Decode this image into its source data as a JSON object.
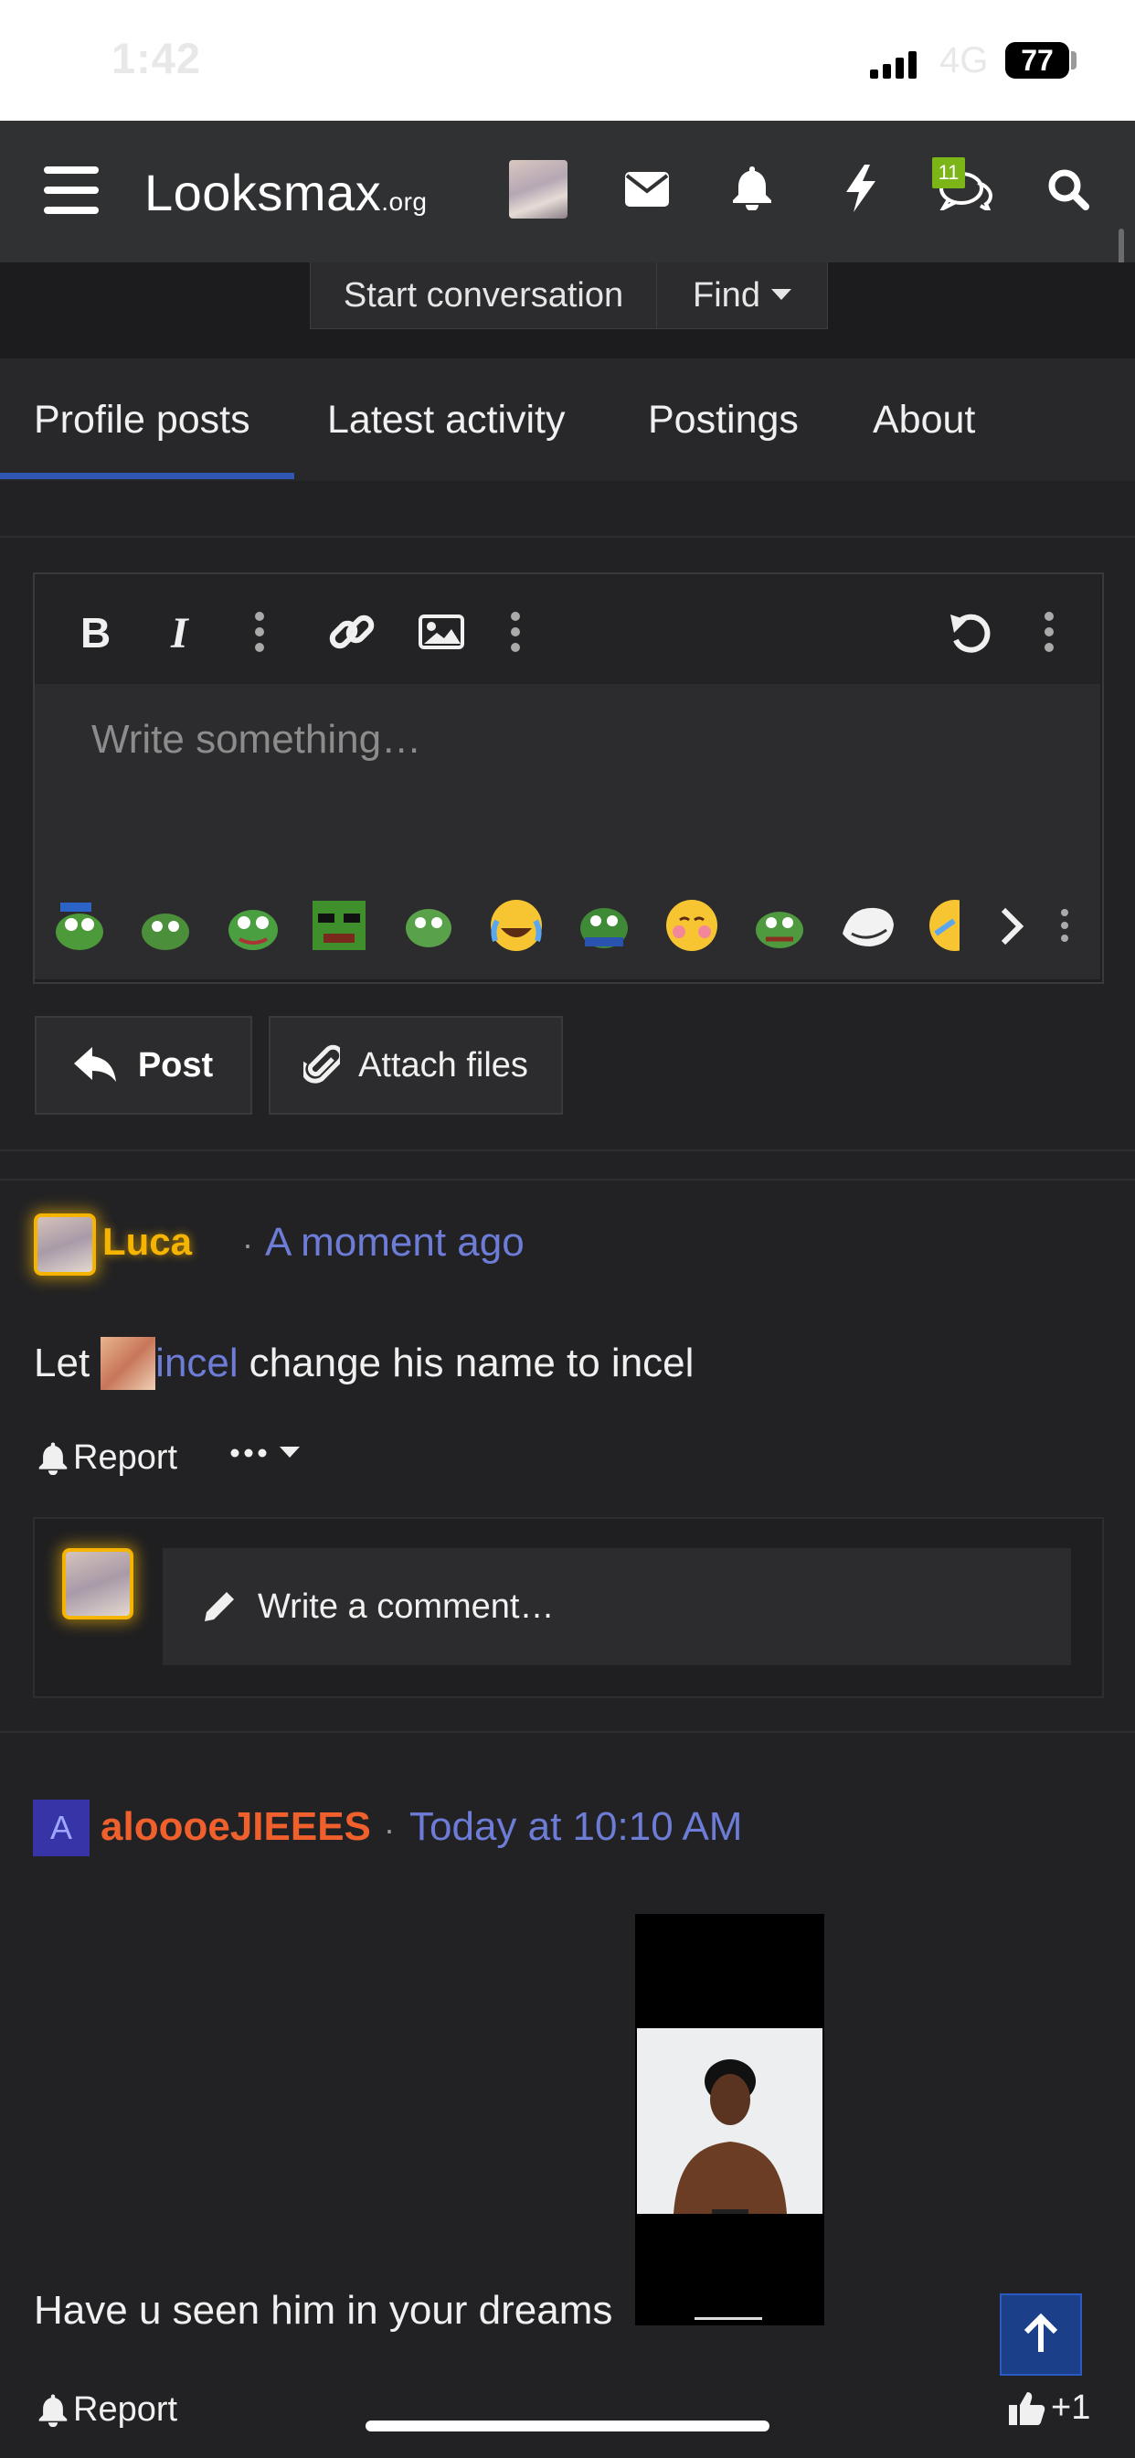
{
  "status_bar": {
    "time": "1:42",
    "network": "4G",
    "battery": "77"
  },
  "nav": {
    "logo_main": "Looksmax",
    "logo_suffix": ".org",
    "conversations_badge": "11"
  },
  "member_actions": {
    "start_conversation": "Start conversation",
    "find": "Find"
  },
  "tabs": [
    {
      "label": "Profile posts",
      "active": true
    },
    {
      "label": "Latest activity",
      "active": false
    },
    {
      "label": "Postings",
      "active": false
    },
    {
      "label": "About",
      "active": false
    }
  ],
  "editor": {
    "placeholder": "Write something…",
    "post_button": "Post",
    "attach_button": "Attach files"
  },
  "posts": [
    {
      "username": "Luca",
      "time": "A moment ago",
      "text_before": "Let",
      "mention": "incel",
      "text_after": "change his name to incel",
      "report": "Report",
      "comment_placeholder": "Write a comment…"
    },
    {
      "avatar_letter": "A",
      "username": "aloooeJIEEES",
      "time": "Today at 10:10 AM",
      "text": "Have u seen him in your dreams",
      "report": "Report",
      "reaction": "+1"
    }
  ],
  "colors": {
    "accent_gold": "#f5b400",
    "link_blue": "#6d7cd6",
    "username_orange": "#f0602c",
    "tab_underline": "#2f57b3"
  }
}
